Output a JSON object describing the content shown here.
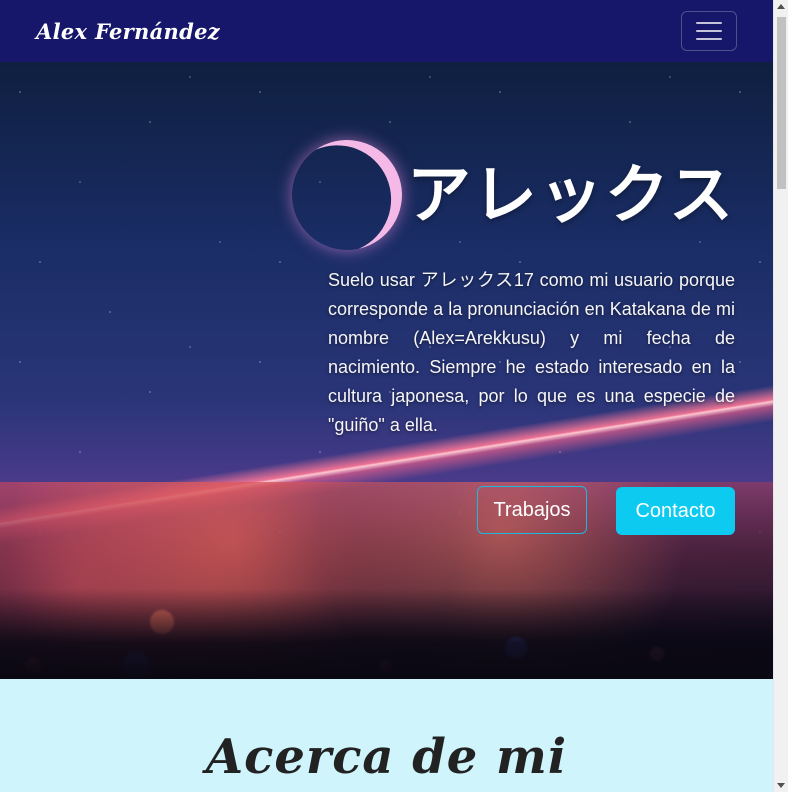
{
  "navbar": {
    "brand": "Alex Fernández",
    "toggler_icon": "hamburger-menu-icon"
  },
  "hero": {
    "title": "アレックス",
    "description": "Suelo usar アレックス17 como mi usuario porque corresponde a la pronunciación en Katakana de mi nombre (Alex=Arekkusu) y mi fecha de nacimiento. Siempre he estado interesado en la cultura japonesa, por lo que es una especie de \"guiño\" a ella.",
    "buttons": {
      "works": "Trabajos",
      "contact": "Contacto"
    }
  },
  "about": {
    "title": "Acerca de mi"
  },
  "colors": {
    "navbar_bg": "#16166a",
    "accent": "#0dcaf0",
    "about_bg": "#cff4fc"
  }
}
